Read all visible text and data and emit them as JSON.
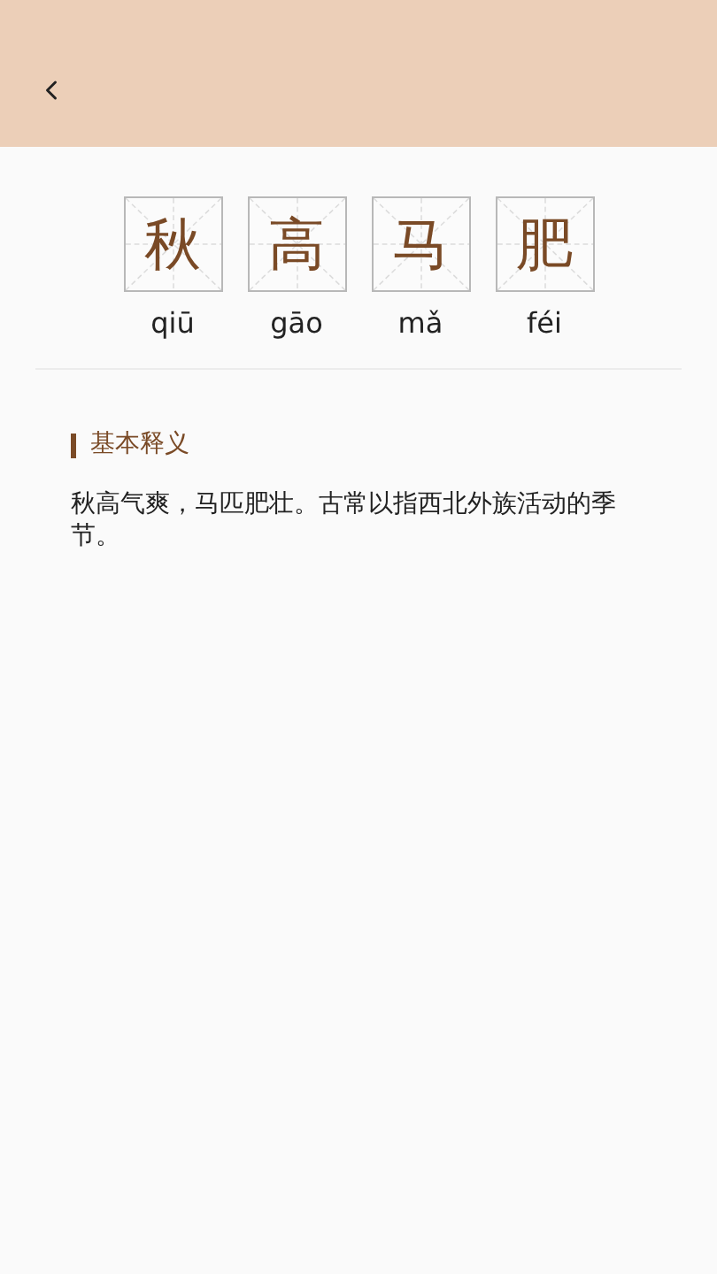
{
  "characters": [
    {
      "char": "秋",
      "pinyin": "qiū"
    },
    {
      "char": "高",
      "pinyin": "gāo"
    },
    {
      "char": "马",
      "pinyin": "mǎ"
    },
    {
      "char": "肥",
      "pinyin": "féi"
    }
  ],
  "section": {
    "title": "基本释义",
    "text": "秋高气爽，马匹肥壮。古常以指西北外族活动的季节。"
  }
}
